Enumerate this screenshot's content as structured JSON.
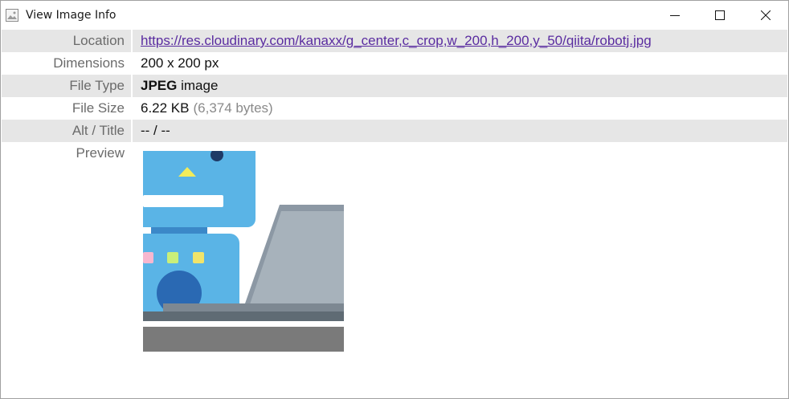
{
  "window": {
    "title": "View Image Info",
    "icon": "image-icon",
    "controls": [
      "minimize-icon",
      "maximize-icon",
      "close-icon"
    ]
  },
  "rows": {
    "location": {
      "label": "Location",
      "value": "https://res.cloudinary.com/kanaxx/g_center,c_crop,w_200,h_200,y_50/qiita/robotj.jpg"
    },
    "dimensions": {
      "label": "Dimensions",
      "value": "200 x 200 px"
    },
    "file_type": {
      "label": "File Type",
      "format": "JPEG",
      "suffix": "image"
    },
    "file_size": {
      "label": "File Size",
      "value": "6.22 KB",
      "bytes": "(6,374 bytes)"
    },
    "alt_title": {
      "label": "Alt / Title",
      "value": "-- / --"
    },
    "preview": {
      "label": "Preview"
    }
  },
  "colors": {
    "link": "#5a2ca0",
    "row_alt_bg": "#e6e6e6",
    "label_text": "#6b6b6b"
  }
}
